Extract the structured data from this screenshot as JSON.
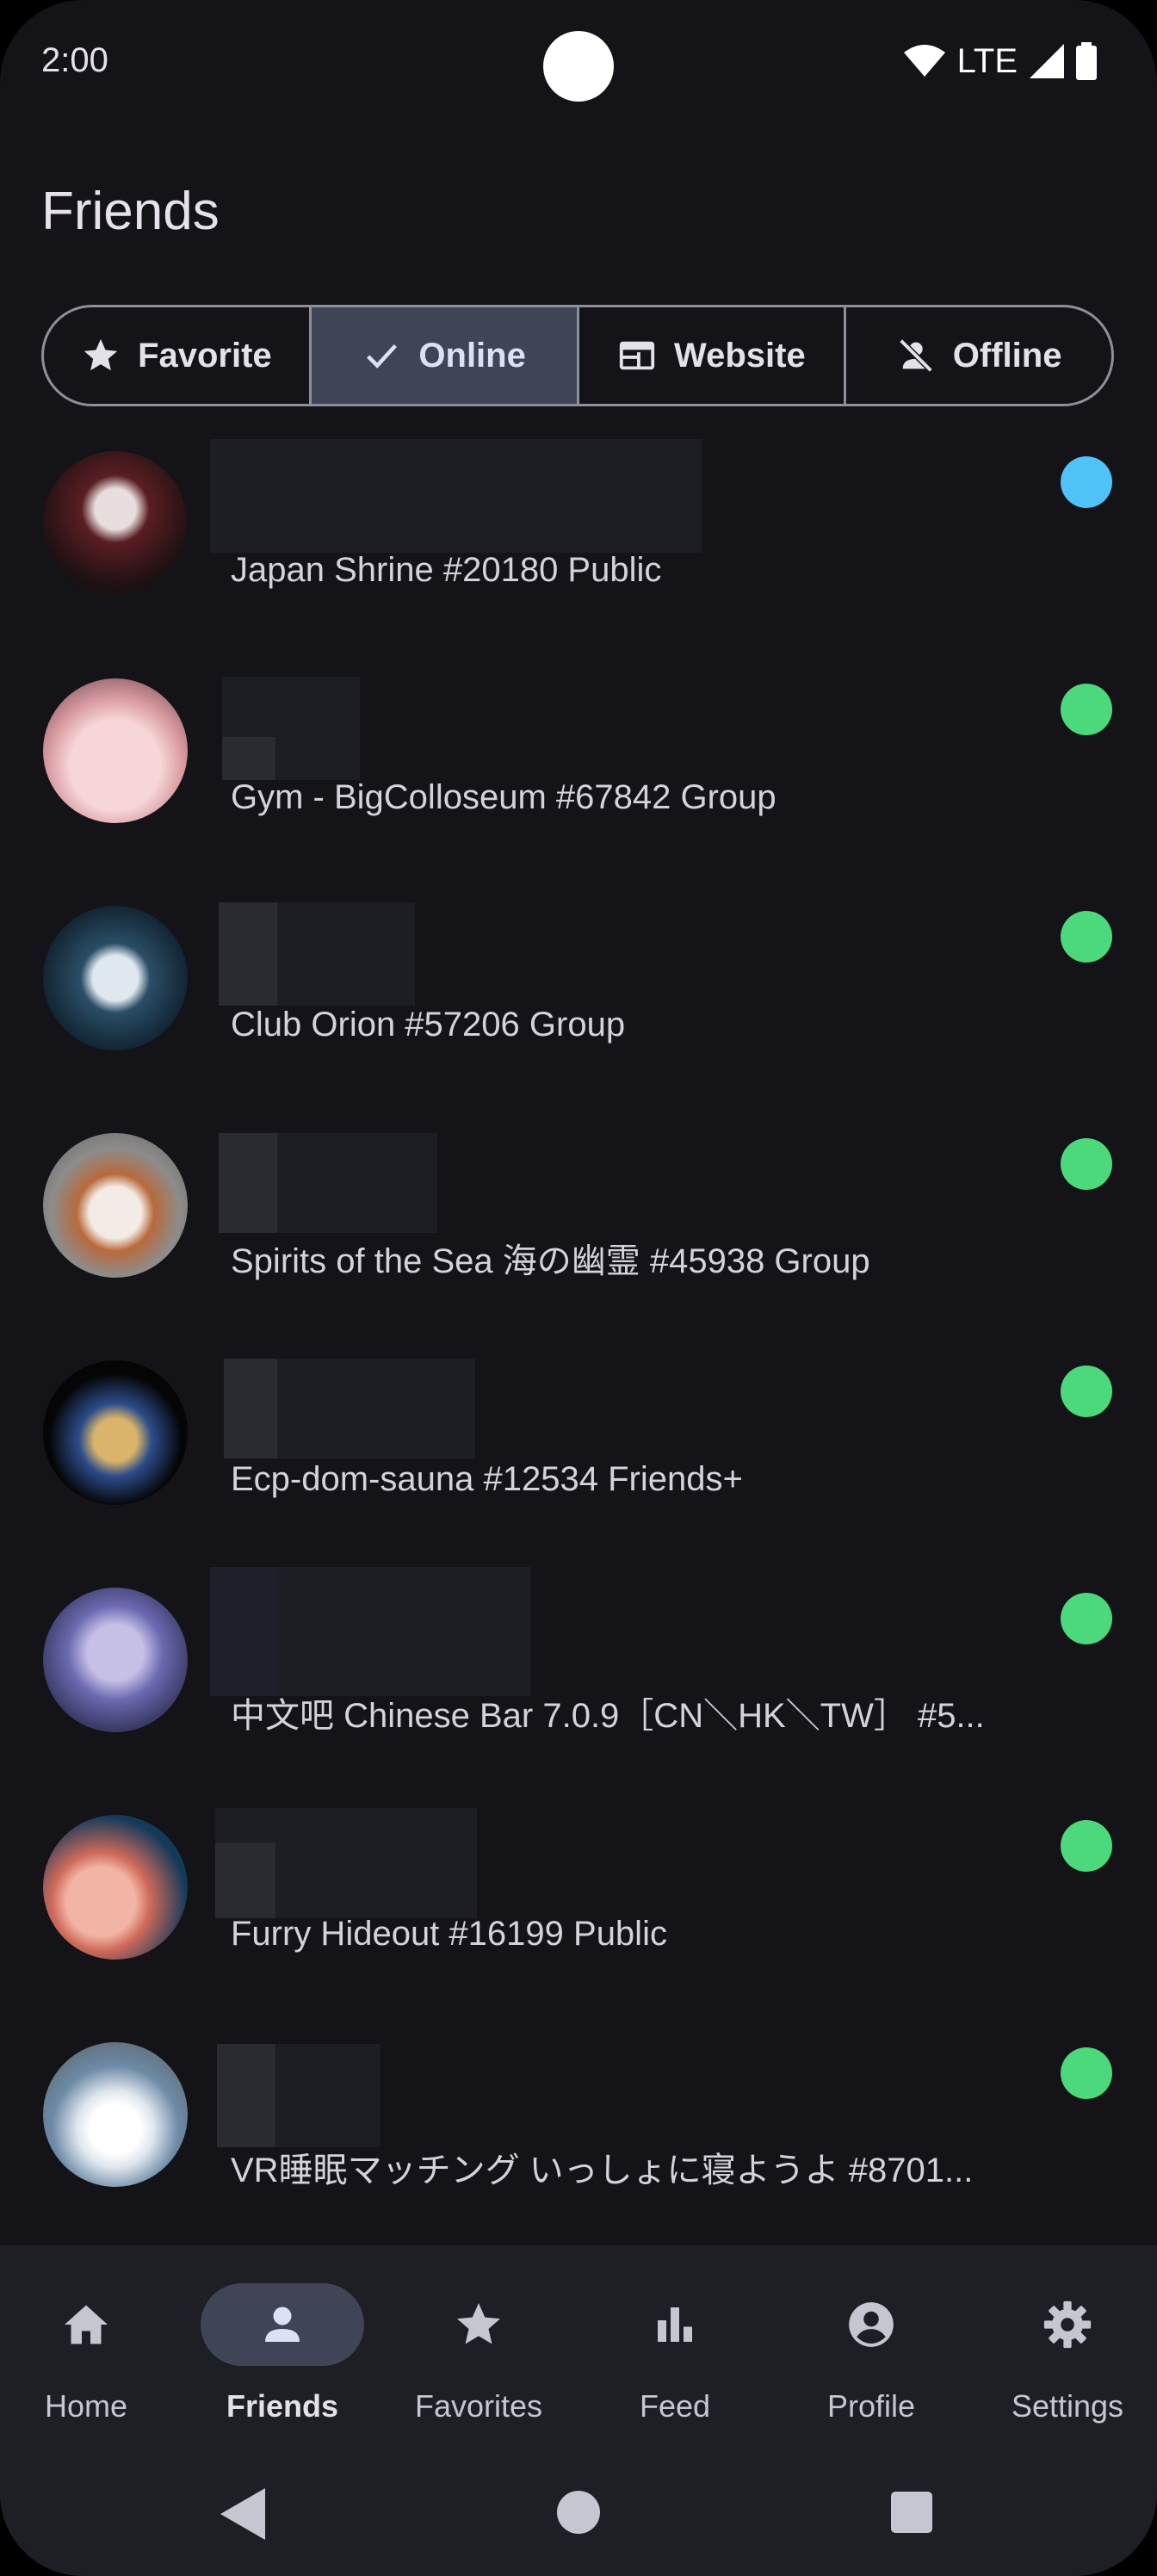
{
  "status_bar": {
    "time": "2:00",
    "network": "LTE"
  },
  "page": {
    "title": "Friends"
  },
  "filter_tabs": [
    {
      "label": "Favorite",
      "icon": "star-icon",
      "active": false
    },
    {
      "label": "Online",
      "icon": "check-icon",
      "active": true
    },
    {
      "label": "Website",
      "icon": "web-icon",
      "active": false
    },
    {
      "label": "Offline",
      "icon": "person-off-icon",
      "active": false
    }
  ],
  "friends": [
    {
      "location": "Japan Shrine #20180 Public",
      "status_color": "#4FC3F7"
    },
    {
      "location": "Gym - BigColloseum #67842 Group",
      "status_color": "#4CD97B"
    },
    {
      "location": "Club Orion #57206 Group",
      "status_color": "#4CD97B"
    },
    {
      "location": "Spirits of the Sea 海の幽霊 #45938 Group",
      "status_color": "#4CD97B"
    },
    {
      "location": "Ecp-dom-sauna #12534 Friends+",
      "status_color": "#4CD97B"
    },
    {
      "location": "中文吧 Chinese Bar 7.0.9［CN＼HK＼TW］ #5...",
      "status_color": "#4CD97B"
    },
    {
      "location": "Furry Hideout #16199 Public",
      "status_color": "#4CD97B"
    },
    {
      "location": "VR睡眠マッチング いっしょに寝ようよ #8701...",
      "status_color": "#4CD97B"
    }
  ],
  "bottom_nav": [
    {
      "label": "Home",
      "icon": "home-icon"
    },
    {
      "label": "Friends",
      "icon": "person-icon",
      "active": true
    },
    {
      "label": "Favorites",
      "icon": "star-icon"
    },
    {
      "label": "Feed",
      "icon": "bar-chart-icon"
    },
    {
      "label": "Profile",
      "icon": "account-circle-icon"
    },
    {
      "label": "Settings",
      "icon": "gear-icon"
    }
  ]
}
